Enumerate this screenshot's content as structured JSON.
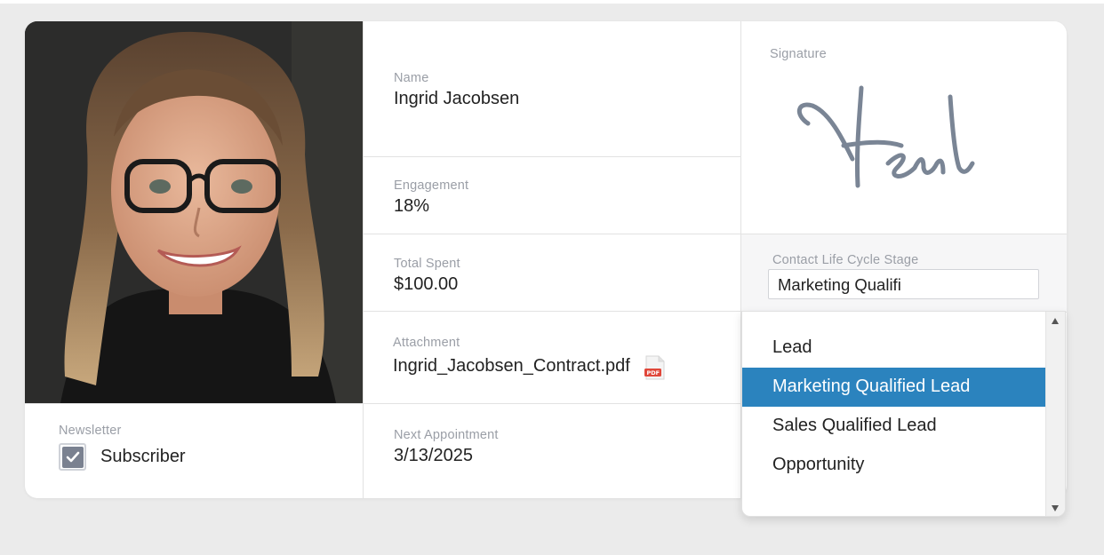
{
  "fields": {
    "name": {
      "label": "Name",
      "value": "Ingrid Jacobsen"
    },
    "engagement": {
      "label": "Engagement",
      "value": "18%"
    },
    "total_spent": {
      "label": "Total Spent",
      "value": "$100.00"
    },
    "attachment": {
      "label": "Attachment",
      "value": "Ingrid_Jacobsen_Contract.pdf",
      "icon": "pdf-file-icon"
    },
    "next_appointment": {
      "label": "Next Appointment",
      "value": "3/13/2025"
    },
    "newsletter": {
      "label": "Newsletter",
      "option": "Subscriber",
      "checked": true
    },
    "signature": {
      "label": "Signature"
    },
    "lifecycle": {
      "label": "Contact Life Cycle Stage",
      "input_value": "Marketing Qualifi",
      "options": [
        "Lead",
        "Marketing Qualified Lead",
        "Sales Qualified Lead",
        "Opportunity"
      ],
      "selected_index": 1
    }
  },
  "colors": {
    "accent": "#2b83be",
    "checkbox": "#7a8190",
    "signature_ink": "#7a8595",
    "pdf_badge": "#e0473a"
  }
}
